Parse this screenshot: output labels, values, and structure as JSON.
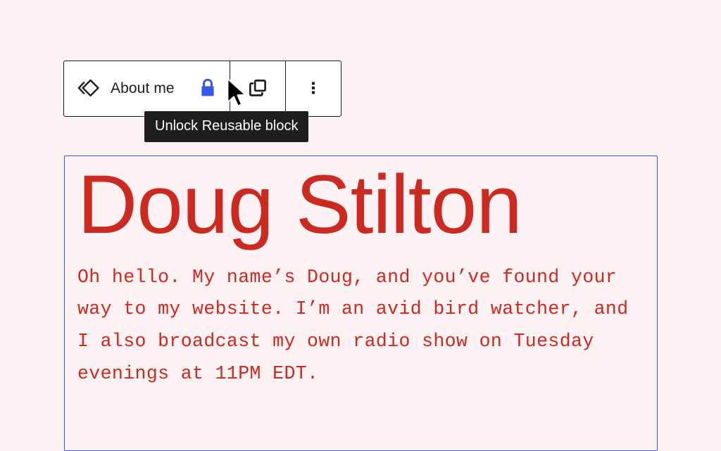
{
  "page": {
    "background_color": "#fdf2f3",
    "accent_red": "#cc2a20",
    "selection_blue": "#3858e9",
    "lock_blue": "#3858e9",
    "toolbar_border": "#1e1e1e"
  },
  "toolbar": {
    "block_type_label": "About me",
    "block_type_icon": "reusable-block-icon",
    "lock_icon": "lock-icon",
    "lock_button_title": "Unlock Reusable block",
    "duplicate_icon": "copy-icon",
    "options_icon": "kebab-menu-icon"
  },
  "tooltip": {
    "text": "Unlock Reusable block"
  },
  "cursor": {
    "icon": "arrow-cursor-icon"
  },
  "block": {
    "heading": "Doug Stilton",
    "paragraph": "Oh hello. My name’s Doug, and you’ve found your way to my website. I’m an avid bird watcher, and I also broadcast my own radio show on Tuesday evenings at 11PM EDT."
  }
}
